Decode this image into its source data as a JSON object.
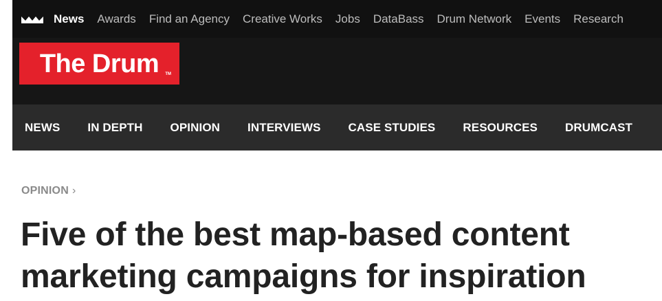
{
  "topnav": {
    "items": [
      "News",
      "Awards",
      "Find an Agency",
      "Creative Works",
      "Jobs",
      "DataBass",
      "Drum Network",
      "Events",
      "Research"
    ],
    "active_index": 0
  },
  "brand": {
    "logo_text": "The Drum",
    "logo_tm": "TM",
    "logo_color": "#e4212b"
  },
  "mainnav": {
    "items": [
      "NEWS",
      "IN DEPTH",
      "OPINION",
      "INTERVIEWS",
      "CASE STUDIES",
      "RESOURCES",
      "DRUMCAST"
    ]
  },
  "breadcrumb": {
    "label": "OPINION",
    "chevron": "›"
  },
  "article": {
    "headline_line1": "Five of the best map-based content",
    "headline_line2": "marketing campaigns for inspiration"
  }
}
